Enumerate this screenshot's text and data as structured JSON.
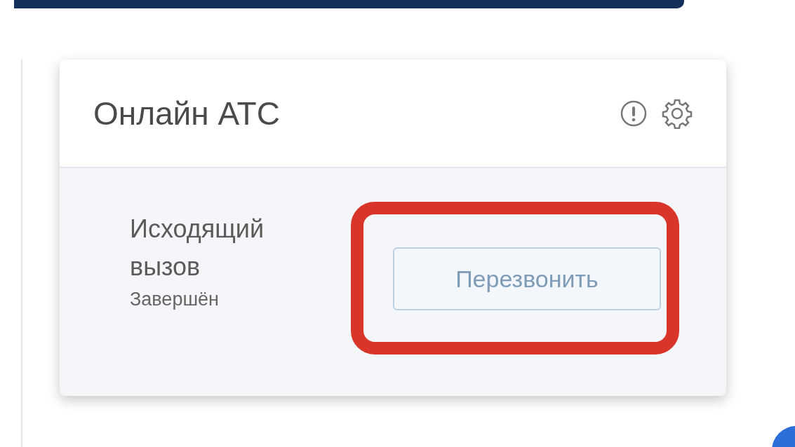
{
  "widget": {
    "title": "Онлайн АТС",
    "call": {
      "type": "Исходящий вызов",
      "status": "Завершён"
    },
    "callback_button": {
      "label": "Перезвонить",
      "highlighted": true
    }
  }
}
